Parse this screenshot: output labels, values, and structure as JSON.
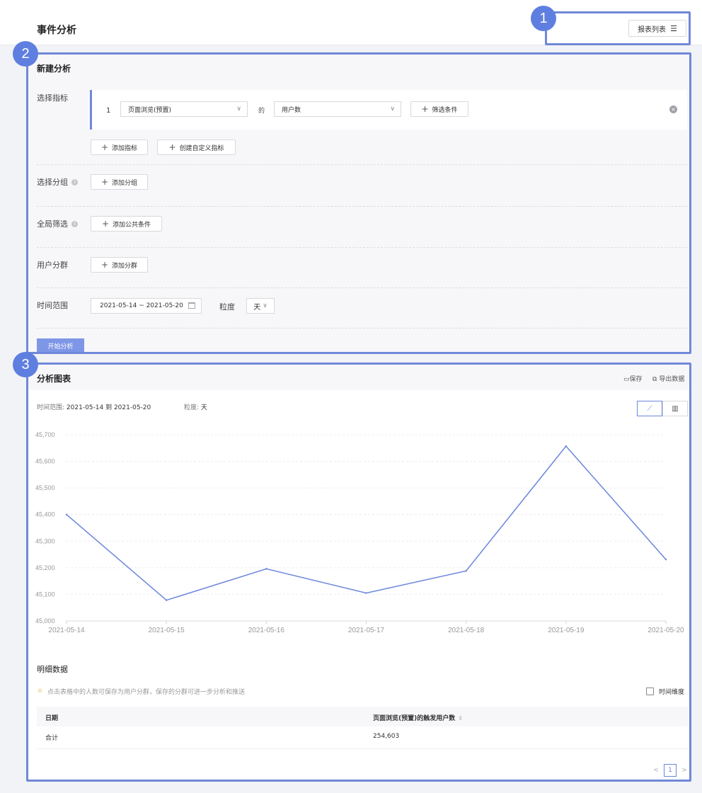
{
  "header": {
    "title": "事件分析",
    "report_list_label": "报表列表",
    "list_icon": "list-icon"
  },
  "markers": [
    "1",
    "2",
    "3"
  ],
  "builder": {
    "title": "新建分析",
    "metric_label": "选择指标",
    "metric_row": {
      "index": "1",
      "event_value": "页面浏览(预置)",
      "of_text": "的",
      "measure_value": "用户数",
      "filter_button": "筛选条件"
    },
    "add_metric_button": "添加指标",
    "create_custom_metric_button": "创建自定义指标",
    "group_label": "选择分组",
    "add_group_button": "添加分组",
    "global_filter_label": "全局筛选",
    "add_common_condition_button": "添加公共条件",
    "segment_label": "用户分群",
    "add_segment_button": "添加分群",
    "time_range_label": "时间范围",
    "date_range": "2021-05-14  ~  2021-05-20",
    "granularity_label": "粒度",
    "granularity_value": "天",
    "start_button": "开始分析"
  },
  "results": {
    "title": "分析图表",
    "save_label": "保存",
    "export_label": "导出数据",
    "time_range_key": "时间范围:",
    "time_range_value": "2021-05-14 到 2021-05-20",
    "granularity_key": "粒度:",
    "granularity_value": "天",
    "detail_title": "明细数据",
    "tip_text": "点击表格中的人数可保存为用户分群，保存的分群可进一步分析和推送",
    "time_dimension_label": "时间维度",
    "table": {
      "columns": [
        "日期",
        "页面浏览(预置)的触发用户数"
      ],
      "rows": [
        [
          "合计",
          "254,603"
        ]
      ]
    },
    "pagination": {
      "current": "1",
      "prev": "<",
      "next": ">"
    }
  },
  "chart_data": {
    "type": "line",
    "x": [
      "2021-05-14",
      "2021-05-15",
      "2021-05-16",
      "2021-05-17",
      "2021-05-18",
      "2021-05-19",
      "2021-05-20"
    ],
    "series": [
      {
        "values": [
          45400,
          45078,
          45196,
          45105,
          45188,
          45657,
          45231
        ]
      }
    ],
    "ylim": [
      45000,
      45700
    ],
    "y_ticks": [
      "45,000",
      "45,100",
      "45,200",
      "45,300",
      "45,400",
      "45,500",
      "45,600",
      "45,700"
    ],
    "grid": true,
    "line_color": "#6b86dc"
  }
}
